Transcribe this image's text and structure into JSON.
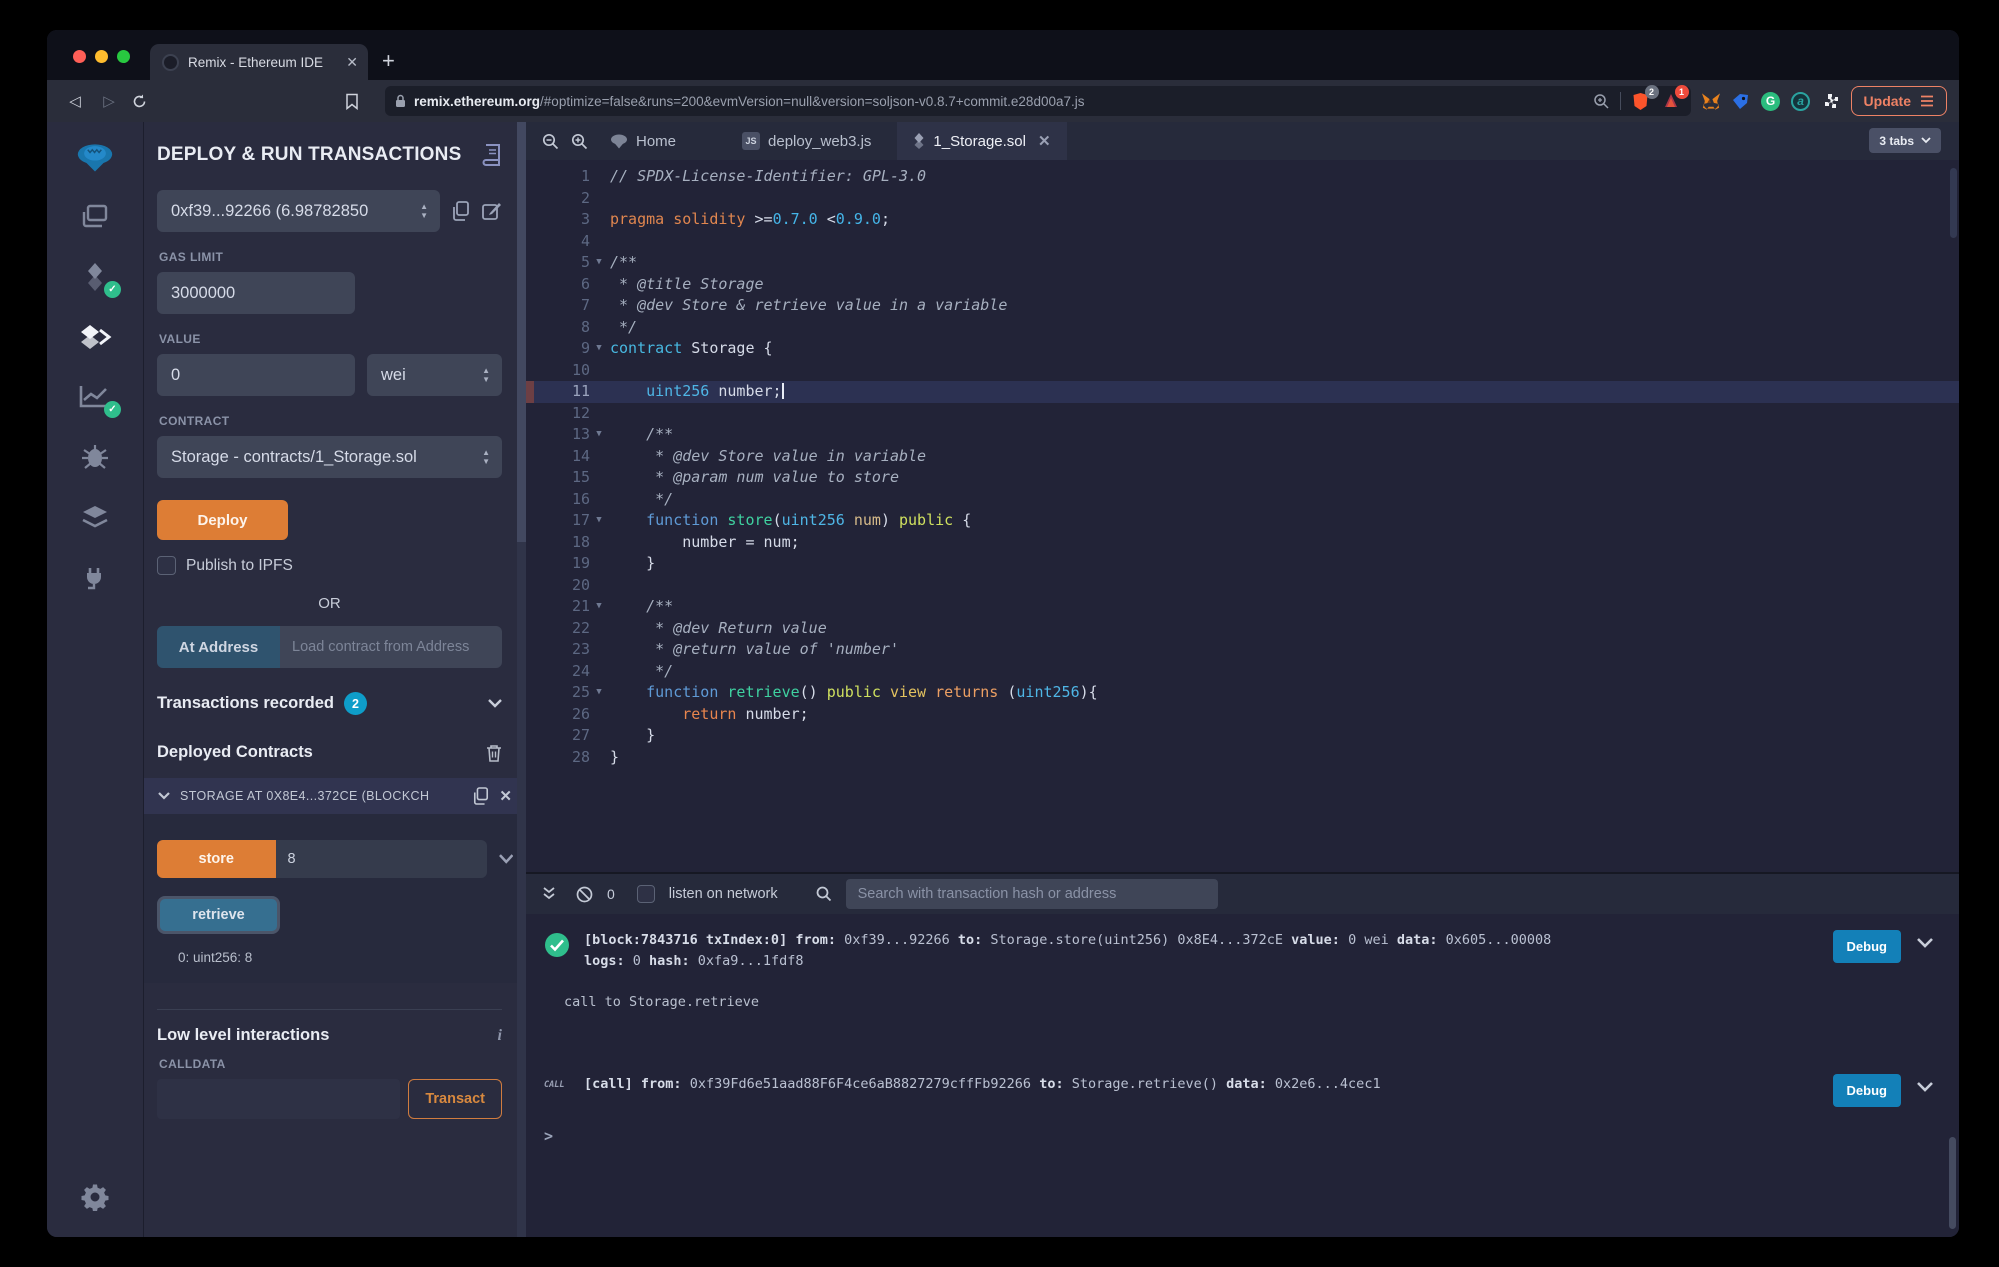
{
  "browser": {
    "tab_title": "Remix - Ethereum IDE",
    "close_tab": "✕",
    "url_host": "remix.ethereum.org",
    "url_rest": "/#optimize=false&runs=200&evmVersion=null&version=soljson-v0.8.7+commit.e28d00a7.js",
    "shield_badge": "2",
    "flame_badge": "1",
    "grammarly_letter": "G",
    "teal_letter": "a",
    "update_label": "Update"
  },
  "panel": {
    "title": "DEPLOY & RUN TRANSACTIONS",
    "account_value": "0xf39...92266 (6.98782850",
    "gas_label": "GAS LIMIT",
    "gas_value": "3000000",
    "value_label": "VALUE",
    "value_value": "0",
    "unit_value": "wei",
    "contract_label": "CONTRACT",
    "contract_value": "Storage - contracts/1_Storage.sol",
    "deploy_label": "Deploy",
    "publish_label": "Publish to IPFS",
    "or_label": "OR",
    "at_address_label": "At Address",
    "at_address_placeholder": "Load contract from Address",
    "tx_recorded_label": "Transactions recorded",
    "tx_recorded_count": "2",
    "deployed_label": "Deployed Contracts",
    "deployed_item_title": "STORAGE AT 0X8E4...372CE (BLOCKCH",
    "store_label": "store",
    "store_value": "8",
    "retrieve_label": "retrieve",
    "retrieve_output": "0: uint256: 8",
    "lowlevel_title": "Low level interactions",
    "calldata_label": "CALLDATA",
    "transact_label": "Transact"
  },
  "editor": {
    "tabs": [
      {
        "label": "Home"
      },
      {
        "label": "deploy_web3.js"
      },
      {
        "label": "1_Storage.sol"
      }
    ],
    "js_glyph": "JS",
    "tabs_count": "3 tabs",
    "code_lines": [
      {
        "n": 1,
        "seg": [
          {
            "c": "cm",
            "t": "// SPDX-License-Identifier: GPL-3.0"
          }
        ]
      },
      {
        "n": 2,
        "seg": []
      },
      {
        "n": 3,
        "seg": [
          {
            "c": "prag",
            "t": "pragma solidity "
          },
          {
            "c": "pl",
            "t": ">="
          },
          {
            "c": "num",
            "t": "0.7.0"
          },
          {
            "c": "pl",
            "t": " <"
          },
          {
            "c": "num",
            "t": "0.9.0"
          },
          {
            "c": "pl",
            "t": ";"
          }
        ]
      },
      {
        "n": 4,
        "seg": []
      },
      {
        "n": 5,
        "fold": true,
        "seg": [
          {
            "c": "cm",
            "t": "/**"
          }
        ]
      },
      {
        "n": 6,
        "seg": [
          {
            "c": "cm",
            "t": " * @title Storage"
          }
        ]
      },
      {
        "n": 7,
        "seg": [
          {
            "c": "cm",
            "t": " * @dev Store & retrieve value in a variable"
          }
        ]
      },
      {
        "n": 8,
        "seg": [
          {
            "c": "cm",
            "t": " */"
          }
        ]
      },
      {
        "n": 9,
        "fold": true,
        "seg": [
          {
            "c": "ctr",
            "t": "contract"
          },
          {
            "c": "pl",
            "t": " Storage {"
          }
        ]
      },
      {
        "n": 10,
        "seg": []
      },
      {
        "n": 11,
        "cur": true,
        "cursor": true,
        "mark": true,
        "seg": [
          {
            "c": "typ",
            "t": "    uint256"
          },
          {
            "c": "pl",
            "t": " number;"
          }
        ]
      },
      {
        "n": 12,
        "seg": []
      },
      {
        "n": 13,
        "fold": true,
        "seg": [
          {
            "c": "cm",
            "t": "    /**"
          }
        ]
      },
      {
        "n": 14,
        "seg": [
          {
            "c": "cm",
            "t": "     * @dev Store value in variable"
          }
        ]
      },
      {
        "n": 15,
        "seg": [
          {
            "c": "cm",
            "t": "     * @param num value to store"
          }
        ]
      },
      {
        "n": 16,
        "seg": [
          {
            "c": "cm",
            "t": "     */"
          }
        ]
      },
      {
        "n": 17,
        "fold": true,
        "seg": [
          {
            "c": "fnk",
            "t": "    function "
          },
          {
            "c": "fn",
            "t": "store"
          },
          {
            "c": "pl",
            "t": "("
          },
          {
            "c": "typ",
            "t": "uint256"
          },
          {
            "c": "par",
            "t": " num"
          },
          {
            "c": "pl",
            "t": ") "
          },
          {
            "c": "pub",
            "t": "public"
          },
          {
            "c": "pl",
            "t": " {"
          }
        ]
      },
      {
        "n": 18,
        "seg": [
          {
            "c": "pl",
            "t": "        number = num;"
          }
        ]
      },
      {
        "n": 19,
        "seg": [
          {
            "c": "pl",
            "t": "    }"
          }
        ]
      },
      {
        "n": 20,
        "seg": []
      },
      {
        "n": 21,
        "fold": true,
        "seg": [
          {
            "c": "cm",
            "t": "    /**"
          }
        ]
      },
      {
        "n": 22,
        "seg": [
          {
            "c": "cm",
            "t": "     * @dev Return value"
          }
        ]
      },
      {
        "n": 23,
        "seg": [
          {
            "c": "cm",
            "t": "     * @return value of 'number'"
          }
        ]
      },
      {
        "n": 24,
        "seg": [
          {
            "c": "cm",
            "t": "     */"
          }
        ]
      },
      {
        "n": 25,
        "fold": true,
        "seg": [
          {
            "c": "fnk",
            "t": "    function "
          },
          {
            "c": "fn",
            "t": "retrieve"
          },
          {
            "c": "pl",
            "t": "() "
          },
          {
            "c": "pub",
            "t": "public"
          },
          {
            "c": "view",
            "t": " view"
          },
          {
            "c": "rets",
            "t": " returns"
          },
          {
            "c": "pl",
            "t": " ("
          },
          {
            "c": "typ",
            "t": "uint256"
          },
          {
            "c": "pl",
            "t": "){"
          }
        ]
      },
      {
        "n": 26,
        "seg": [
          {
            "c": "ret",
            "t": "        return"
          },
          {
            "c": "pl",
            "t": " number;"
          }
        ]
      },
      {
        "n": 27,
        "seg": [
          {
            "c": "pl",
            "t": "    }"
          }
        ]
      },
      {
        "n": 28,
        "seg": [
          {
            "c": "pl",
            "t": "}"
          }
        ]
      }
    ]
  },
  "terminal": {
    "zero": "0",
    "listen_label": "listen on network",
    "search_placeholder": "Search with transaction hash or address",
    "tx1_line1": [
      {
        "b": 1,
        "t": "[block:7843716 txIndex:0]"
      },
      {
        "t": " "
      },
      {
        "b": 1,
        "t": "from:"
      },
      {
        "t": " 0xf39...92266 "
      },
      {
        "b": 1,
        "t": "to:"
      },
      {
        "t": " Storage.store(uint256) 0x8E4...372cE "
      },
      {
        "b": 1,
        "t": "value:"
      },
      {
        "t": " 0 wei "
      },
      {
        "b": 1,
        "t": "data:"
      },
      {
        "t": " 0x605...00008 "
      }
    ],
    "tx1_line2": [
      {
        "b": 1,
        "t": "logs:"
      },
      {
        "t": " 0 "
      },
      {
        "b": 1,
        "t": "hash:"
      },
      {
        "t": " 0xfa9...1fdf8"
      }
    ],
    "debug_label": "Debug",
    "note": "call to Storage.retrieve",
    "call_tag": "CALL",
    "call_line": [
      {
        "b": 1,
        "t": "[call]"
      },
      {
        "t": " "
      },
      {
        "b": 1,
        "t": "from:"
      },
      {
        "t": " 0xf39Fd6e51aad88F6F4ce6aB8827279cffFb92266 "
      },
      {
        "b": 1,
        "t": "to:"
      },
      {
        "t": " Storage.retrieve() "
      },
      {
        "b": 1,
        "t": "data:"
      },
      {
        "t": " 0x2e6...4cec1"
      }
    ],
    "prompt": ">"
  },
  "colors": {
    "accent_orange": "#dd7d35",
    "debug_blue": "#1380b8",
    "success_green": "#2fbe8c",
    "badge_blue": "#0e9dc9"
  }
}
